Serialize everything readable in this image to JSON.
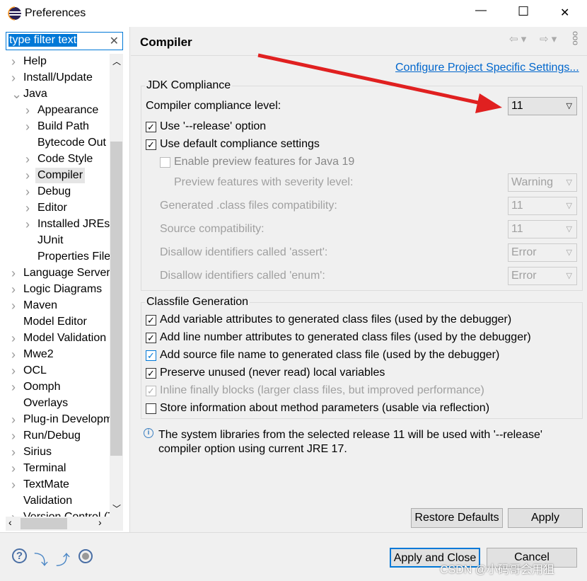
{
  "window": {
    "title": "Preferences",
    "minimize": "—",
    "maximize": "☐",
    "close": "✕"
  },
  "filter": {
    "value": "type filter text",
    "clear": "✕"
  },
  "tree": [
    {
      "label": "Help",
      "level": 0,
      "chevron": true
    },
    {
      "label": "Install/Update",
      "level": 0,
      "chevron": true
    },
    {
      "label": "Java",
      "level": 0,
      "chevron": true,
      "expanded": true
    },
    {
      "label": "Appearance",
      "level": 1,
      "chevron": true
    },
    {
      "label": "Build Path",
      "level": 1,
      "chevron": true
    },
    {
      "label": "Bytecode Out",
      "level": 1,
      "chevron": false
    },
    {
      "label": "Code Style",
      "level": 1,
      "chevron": true
    },
    {
      "label": "Compiler",
      "level": 1,
      "chevron": true,
      "selected": true
    },
    {
      "label": "Debug",
      "level": 1,
      "chevron": true
    },
    {
      "label": "Editor",
      "level": 1,
      "chevron": true
    },
    {
      "label": "Installed JREs",
      "level": 1,
      "chevron": true
    },
    {
      "label": "JUnit",
      "level": 1,
      "chevron": false
    },
    {
      "label": "Properties File",
      "level": 1,
      "chevron": false
    },
    {
      "label": "Language Server",
      "level": 0,
      "chevron": true
    },
    {
      "label": "Logic Diagrams",
      "level": 0,
      "chevron": true
    },
    {
      "label": "Maven",
      "level": 0,
      "chevron": true
    },
    {
      "label": "Model Editor",
      "level": 0,
      "chevron": false
    },
    {
      "label": "Model Validation",
      "level": 0,
      "chevron": true
    },
    {
      "label": "Mwe2",
      "level": 0,
      "chevron": true
    },
    {
      "label": "OCL",
      "level": 0,
      "chevron": true
    },
    {
      "label": "Oomph",
      "level": 0,
      "chevron": true
    },
    {
      "label": "Overlays",
      "level": 0,
      "chevron": false
    },
    {
      "label": "Plug-in Development",
      "level": 0,
      "chevron": true
    },
    {
      "label": "Run/Debug",
      "level": 0,
      "chevron": true
    },
    {
      "label": "Sirius",
      "level": 0,
      "chevron": true
    },
    {
      "label": "Terminal",
      "level": 0,
      "chevron": true
    },
    {
      "label": "TextMate",
      "level": 0,
      "chevron": true
    },
    {
      "label": "Validation",
      "level": 0,
      "chevron": false
    },
    {
      "label": "Version Control (Team)",
      "level": 0,
      "chevron": true
    }
  ],
  "page": {
    "title": "Compiler",
    "configure_link": "Configure Project Specific Settings..."
  },
  "jdk": {
    "title": "JDK Compliance",
    "compliance_label": "Compiler compliance level:",
    "compliance_value": "11",
    "release_option": {
      "label": "Use '--release' option",
      "checked": true
    },
    "default_settings": {
      "label": "Use default compliance settings",
      "checked": true
    },
    "preview": {
      "label": "Enable preview features for Java 19",
      "checked": false
    },
    "rows": [
      {
        "label": "Preview features with severity level:",
        "value": "Warning"
      },
      {
        "label": "Generated .class files compatibility:",
        "value": "11"
      },
      {
        "label": "Source compatibility:",
        "value": "11"
      },
      {
        "label": "Disallow identifiers called 'assert':",
        "value": "Error"
      },
      {
        "label": "Disallow identifiers called 'enum':",
        "value": "Error"
      }
    ]
  },
  "classfile": {
    "title": "Classfile Generation",
    "options": [
      {
        "label": "Add variable attributes to generated class files (used by the debugger)",
        "checked": true,
        "disabled": false
      },
      {
        "label": "Add line number attributes to generated class files (used by the debugger)",
        "checked": true,
        "disabled": false
      },
      {
        "label": "Add source file name to generated class file (used by the debugger)",
        "checked": true,
        "disabled": false
      },
      {
        "label": "Preserve unused (never read) local variables",
        "checked": true,
        "disabled": false
      },
      {
        "label": "Inline finally blocks (larger class files, but improved performance)",
        "checked": true,
        "disabled": true
      },
      {
        "label": "Store information about method parameters (usable via reflection)",
        "checked": false,
        "disabled": false
      }
    ]
  },
  "info": {
    "line1": "The system libraries from the selected release 11 will be used with '--release'",
    "line2": "compiler option using current JRE 17."
  },
  "buttons": {
    "restore": "Restore Defaults",
    "apply": "Apply",
    "apply_close": "Apply and Close",
    "cancel": "Cancel"
  },
  "watermark": "CSDN @小码哥会用狙",
  "colors": {
    "accent": "#0066cc",
    "arrow": "#e02020",
    "selection": "#0078d7"
  }
}
